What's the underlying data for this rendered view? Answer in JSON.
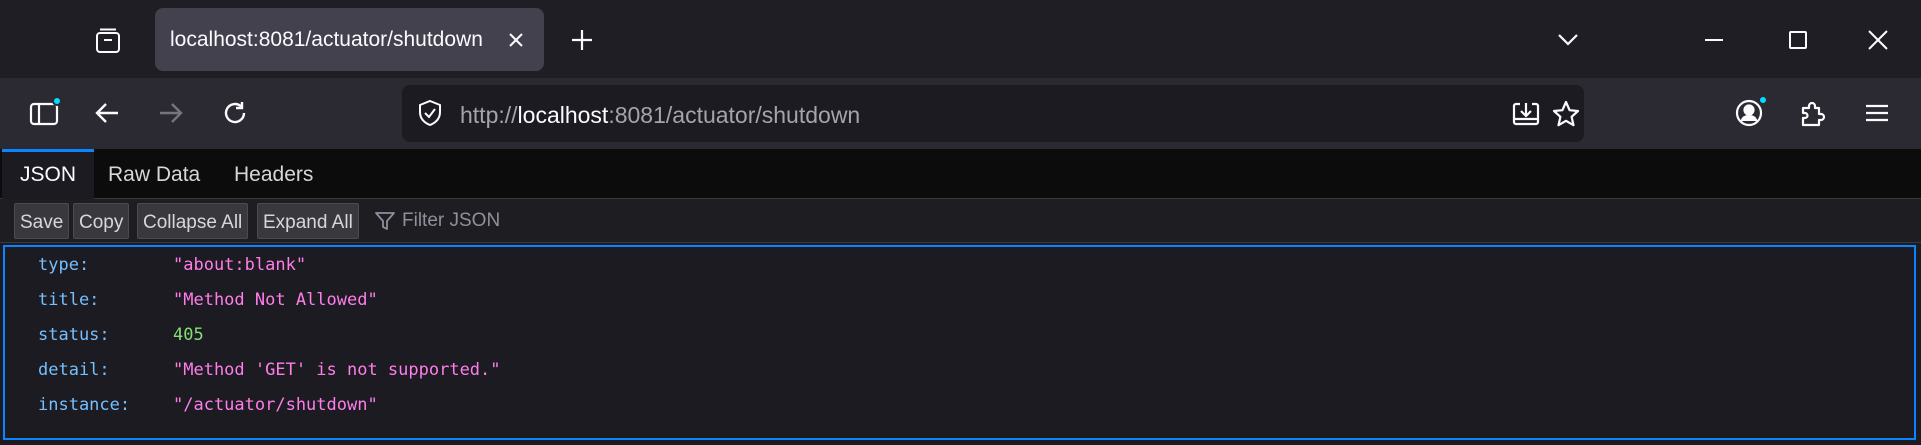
{
  "tab": {
    "title": "localhost:8081/actuator/shutdown"
  },
  "urlbar": {
    "scheme": "http://",
    "host": "localhost",
    "rest": ":8081/actuator/shutdown"
  },
  "viewer": {
    "tabs": [
      "JSON",
      "Raw Data",
      "Headers"
    ],
    "toolbar": {
      "save": "Save",
      "copy": "Copy",
      "collapse_all": "Collapse All",
      "expand_all": "Expand All",
      "filter_placeholder": "Filter JSON"
    },
    "rows": [
      {
        "key": "type:",
        "value": "\"about:blank\"",
        "kind": "str"
      },
      {
        "key": "title:",
        "value": "\"Method Not Allowed\"",
        "kind": "str"
      },
      {
        "key": "status:",
        "value": "405",
        "kind": "num"
      },
      {
        "key": "detail:",
        "value": "\"Method 'GET' is not supported.\"",
        "kind": "str"
      },
      {
        "key": "instance:",
        "value": "\"/actuator/shutdown\"",
        "kind": "str"
      }
    ]
  },
  "icons": {
    "tab_list": "tab-list-icon",
    "close_tab": "close-icon",
    "new_tab": "plus-icon",
    "list_all_tabs": "chevron-down-icon",
    "minimize": "minimize-icon",
    "maximize": "maximize-icon",
    "close_window": "close-icon",
    "sidebar": "sidebar-icon",
    "back": "back-arrow-icon",
    "forward": "forward-arrow-icon",
    "reload": "reload-icon",
    "security": "shield-icon",
    "save_page": "download-icon",
    "bookmark": "star-icon",
    "account": "account-icon",
    "extensions": "puzzle-icon",
    "menu": "hamburger-icon",
    "filter": "funnel-icon"
  },
  "colors": {
    "accent": "#0a84ff",
    "json_key": "#75bfff",
    "json_string": "#ff7de9",
    "json_number": "#86de74",
    "badge": "#00ddff"
  }
}
